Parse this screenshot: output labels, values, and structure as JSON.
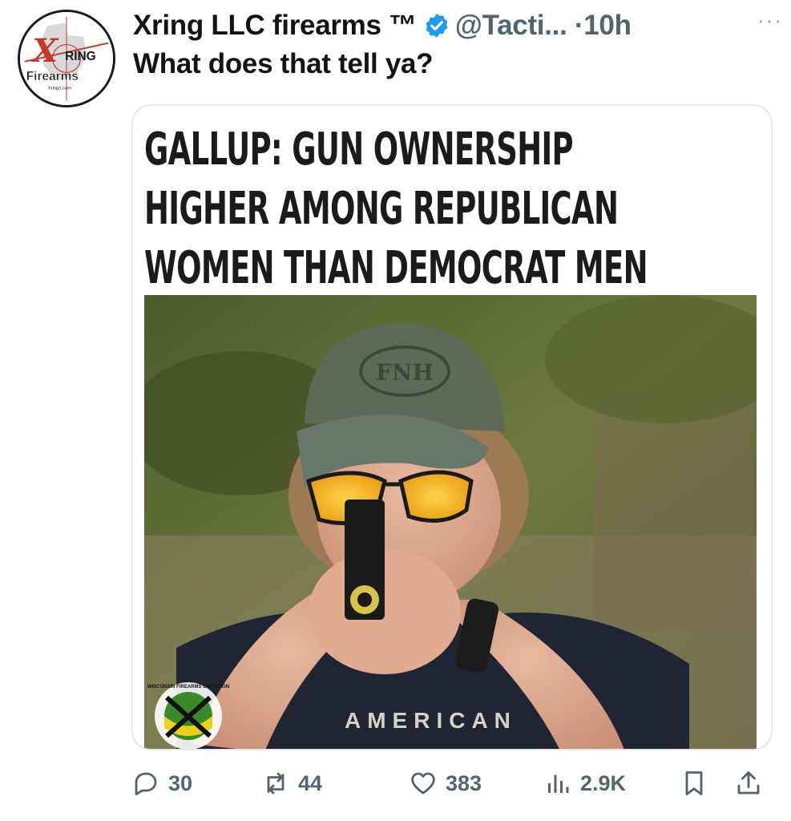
{
  "tweet": {
    "author_name": "Xring LLC firearms ™",
    "handle_time": "@Tacti... ·10h",
    "more_label": "···",
    "text": "What does that tell ya?",
    "verified_color": "#1d9bf0",
    "avatar": {
      "brand_top": "RING",
      "brand_bottom": "Firearms",
      "brand_small": "Xring1.com",
      "accent_color": "#c0392b"
    }
  },
  "card": {
    "headline_lines": [
      "GALLUP: GUN OWNERSHIP",
      "HIGHER AMONG REPUBLICAN",
      "WOMEN THAN DEMOCRAT MEN"
    ],
    "photo": {
      "cap_logo": "FNH",
      "shirt_text": "AMERICAN",
      "watermark_text": "WISCONSIN FIREARMS COALITION"
    }
  },
  "actions": {
    "replies": "30",
    "reposts": "44",
    "likes": "383",
    "views": "2.9K",
    "icon_color": "#536471"
  }
}
